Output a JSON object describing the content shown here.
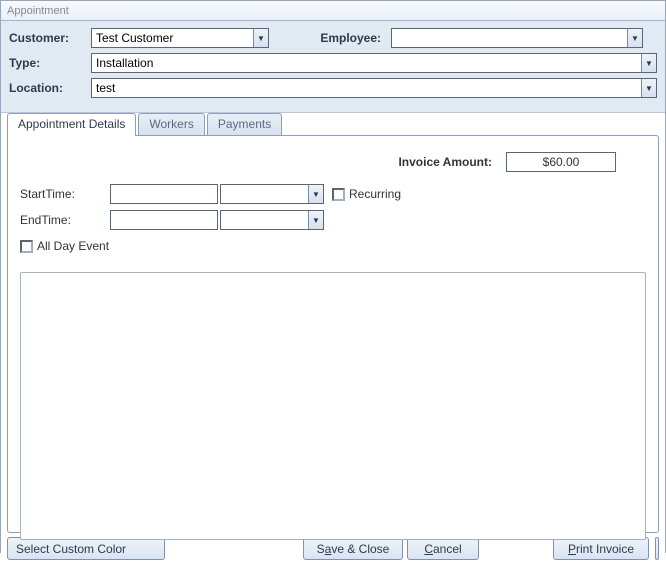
{
  "title": "Appointment",
  "header": {
    "customer_label": "Customer:",
    "customer_value": "Test Customer",
    "employee_label": "Employee:",
    "employee_value": "",
    "type_label": "Type:",
    "type_value": "Installation",
    "location_label": "Location:",
    "location_value": "test"
  },
  "tabs": [
    {
      "label": "Appointment Details",
      "active": true
    },
    {
      "label": "Workers",
      "active": false
    },
    {
      "label": "Payments",
      "active": false
    }
  ],
  "details": {
    "invoice_label": "Invoice Amount:",
    "invoice_value": "$60.00",
    "start_label": "StartTime:",
    "start_date": "",
    "start_time": "",
    "end_label": "EndTime:",
    "end_date": "",
    "end_time": "",
    "recurring_label": "Recurring",
    "allday_label": "All Day Event",
    "notes": ""
  },
  "footer": {
    "select_color": "Select Custom Color",
    "save_close_pre": "S",
    "save_close_u": "a",
    "save_close_post": "ve & Close",
    "cancel_u": "C",
    "cancel_post": "ancel",
    "print_u": "P",
    "print_post": "rint Invoice"
  }
}
